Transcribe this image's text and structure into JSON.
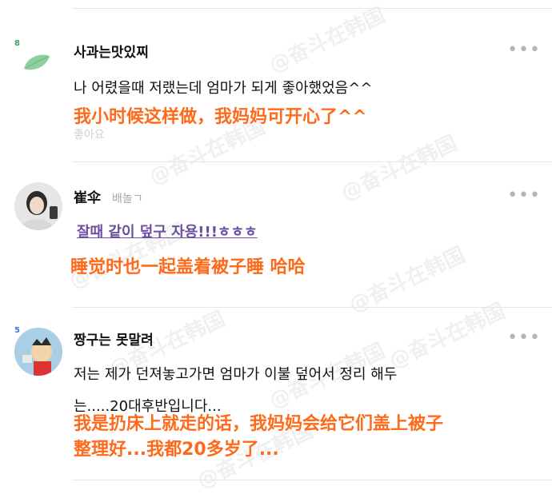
{
  "watermark": "@奋斗在韩国",
  "comments": [
    {
      "badge": "8",
      "username": "사과는맛있찌",
      "text": "나 어렸을때 저랬는데 엄마가 되게 좋아했었음^^",
      "translation": "我小时候这样做，我妈妈可开心了^^",
      "faded_below": "좋아요"
    },
    {
      "username": "崔伞",
      "subtag": "배놀ㄱ",
      "text": "잘때 같이 덮구 자용!!!ㅎㅎㅎ",
      "translation": "睡觉时也一起盖着被子睡 哈哈"
    },
    {
      "badge": "5",
      "username": "짱구는 못말려",
      "text_line1": "저는 제가 던져놓고가면 엄마가 이불 덮어서 정리 해두",
      "text_line2": "는.....20대후반입니다...",
      "translation_line1": "我是扔床上就走的话，我妈妈会给它们盖上被子",
      "translation_line2": "整理好...我都20多岁了..."
    }
  ],
  "more_icon_label": "•••"
}
